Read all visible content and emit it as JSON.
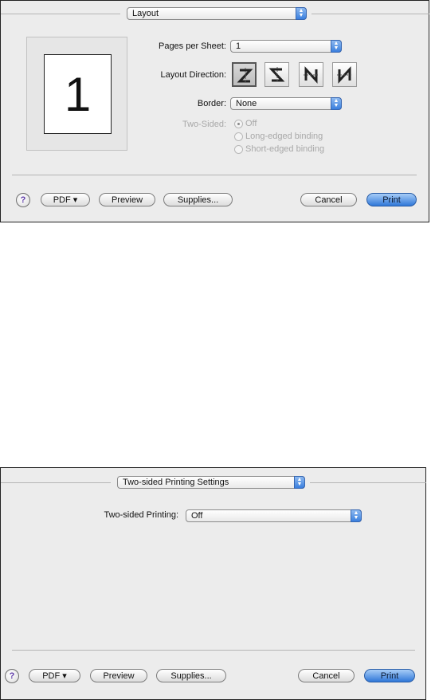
{
  "dialog1": {
    "section_popup": "Layout",
    "preview_page_number": "1",
    "pages_per_sheet_label": "Pages per Sheet:",
    "pages_per_sheet_value": "1",
    "layout_direction_label": "Layout Direction:",
    "layout_directions": [
      "Z",
      "reverse-Z",
      "N-reverse",
      "N"
    ],
    "border_label": "Border:",
    "border_value": "None",
    "two_sided_label": "Two-Sided:",
    "two_sided_options": [
      "Off",
      "Long-edged binding",
      "Short-edged binding"
    ],
    "two_sided_selected": "Off"
  },
  "dialog2": {
    "section_popup": "Two-sided Printing Settings",
    "two_sided_printing_label": "Two-sided Printing:",
    "two_sided_printing_value": "Off"
  },
  "buttons": {
    "help": "?",
    "pdf": "PDF ▾",
    "preview": "Preview",
    "supplies": "Supplies...",
    "cancel": "Cancel",
    "print": "Print"
  },
  "colors": {
    "panel_bg": "#ececec",
    "accent_blue": "#3a7fde",
    "disabled_text": "#a8a8a8"
  }
}
